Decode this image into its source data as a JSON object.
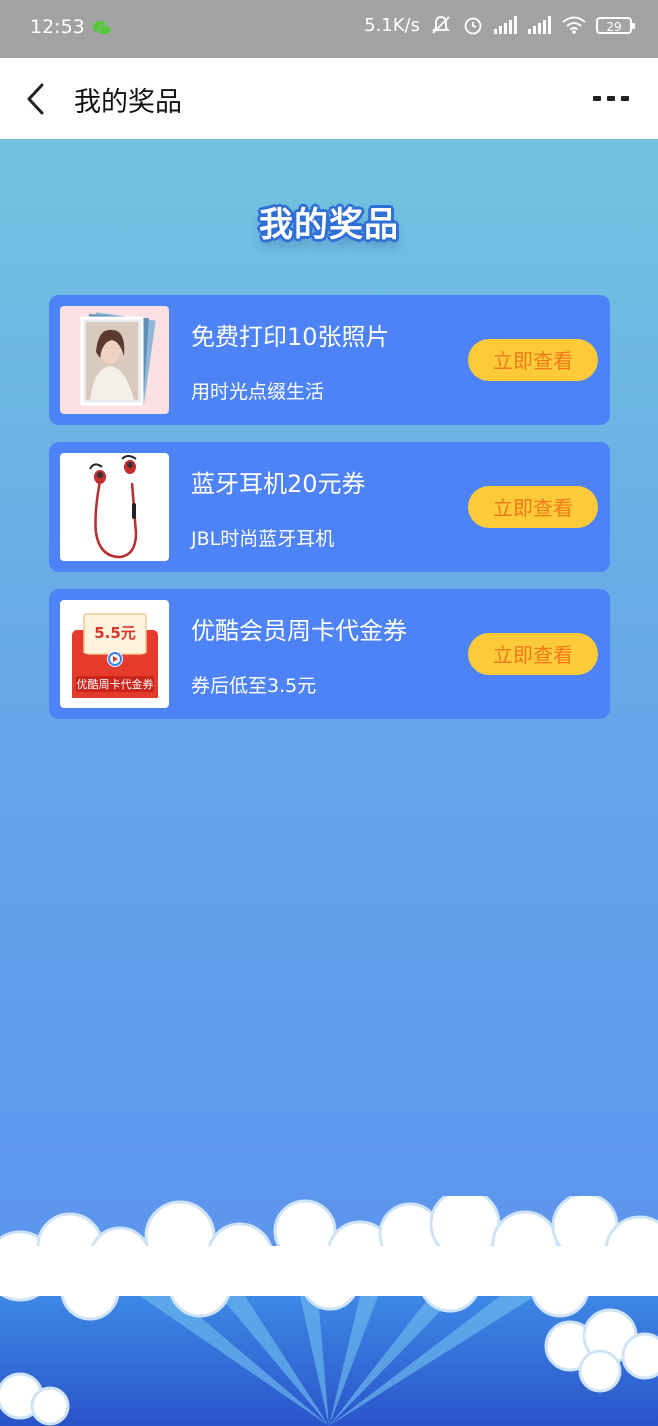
{
  "status_bar": {
    "time": "12:53",
    "network_speed": "5.1K/s",
    "battery": "29",
    "icons": [
      "wechat-icon",
      "mute-bell-icon",
      "alarm-icon",
      "signal-icon",
      "signal-icon",
      "wifi-icon",
      "battery-icon"
    ]
  },
  "app_bar": {
    "title": "我的奖品",
    "back_icon": "chevron-left-icon",
    "more_icon": "more-dots-icon"
  },
  "banner": {
    "title": "我的奖品"
  },
  "prizes": [
    {
      "title": "免费打印10张照片",
      "subtitle": "用时光点缀生活",
      "button": "立即查看",
      "image": "photo-stack-image"
    },
    {
      "title": "蓝牙耳机20元券",
      "subtitle": "JBL时尚蓝牙耳机",
      "button": "立即查看",
      "image": "earphones-image"
    },
    {
      "title": "优酷会员周卡代金券",
      "subtitle": "券后低至3.5元",
      "button": "立即查看",
      "image": "youku-voucher-image",
      "voucher_amount": "5.5元",
      "voucher_label": "优酷周卡代金券"
    }
  ],
  "colors": {
    "card": "#4d83f6",
    "button_bg": "#fdcb3a",
    "button_text": "#f07a18",
    "status_bar": "#a3a3a3"
  }
}
